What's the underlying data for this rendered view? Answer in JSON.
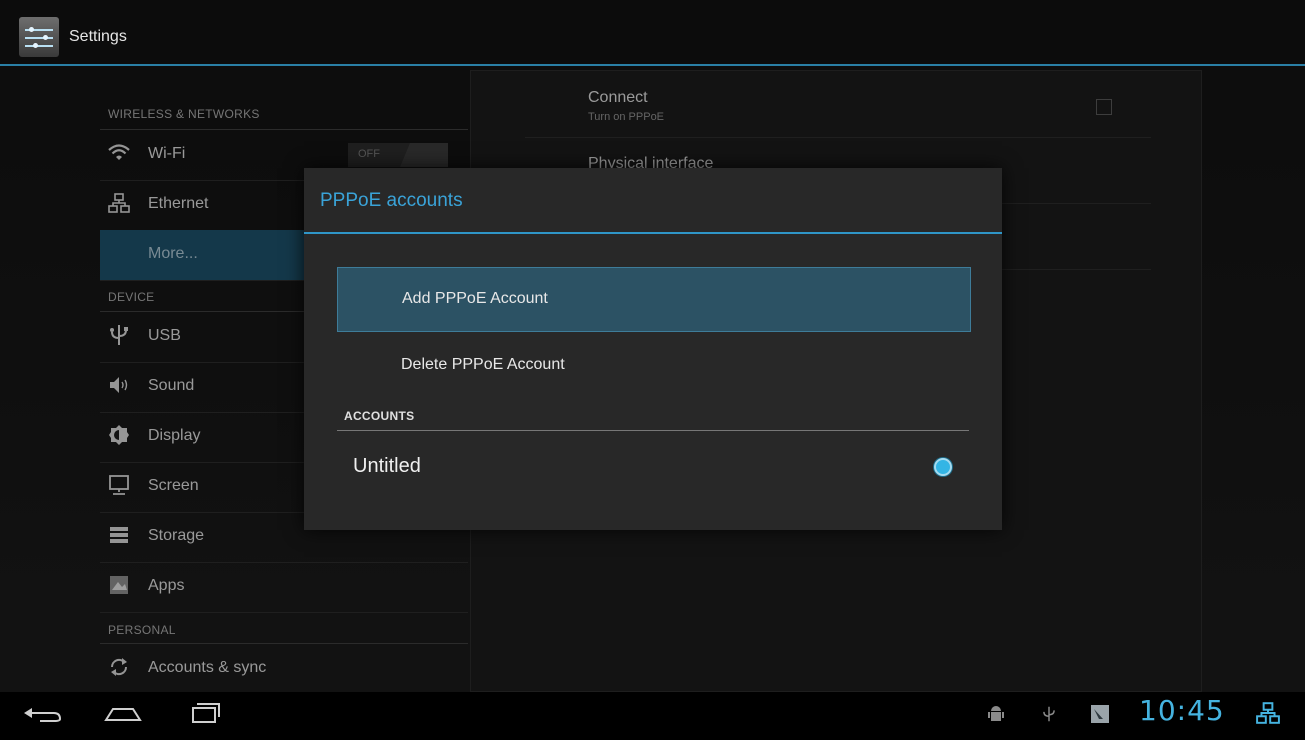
{
  "action_bar": {
    "title": "Settings"
  },
  "left": {
    "headers": {
      "wireless": "WIRELESS & NETWORKS",
      "device": "DEVICE",
      "personal": "PERSONAL"
    },
    "wifi": {
      "label": "Wi-Fi",
      "toggle": "OFF"
    },
    "ethernet": "Ethernet",
    "more": "More...",
    "usb": "USB",
    "sound": "Sound",
    "display": "Display",
    "screen": "Screen",
    "storage": "Storage",
    "apps": "Apps",
    "accounts_sync": "Accounts & sync"
  },
  "right": {
    "connect": {
      "title": "Connect",
      "summary": "Turn on PPPoE"
    },
    "physical_interface": {
      "title": "Physical interface"
    }
  },
  "dialog": {
    "title": "PPPoE accounts",
    "add": "Add PPPoE Account",
    "delete": "Delete PPPoE Account",
    "accounts_header": "ACCOUNTS",
    "account": "Untitled"
  },
  "status_bar": {
    "time": "10:45"
  },
  "colors": {
    "accent": "#33b5e5",
    "selected": "#1d4e67"
  },
  "icons": [
    "settings-icon",
    "wifi-icon",
    "ethernet-icon",
    "usb-icon",
    "sound-icon",
    "display-icon",
    "screen-icon",
    "storage-icon",
    "apps-icon",
    "sync-icon",
    "back-icon",
    "home-icon",
    "recent-apps-icon",
    "android-debug-icon",
    "usb-status-icon",
    "notification-icon",
    "ethernet-status-icon"
  ]
}
